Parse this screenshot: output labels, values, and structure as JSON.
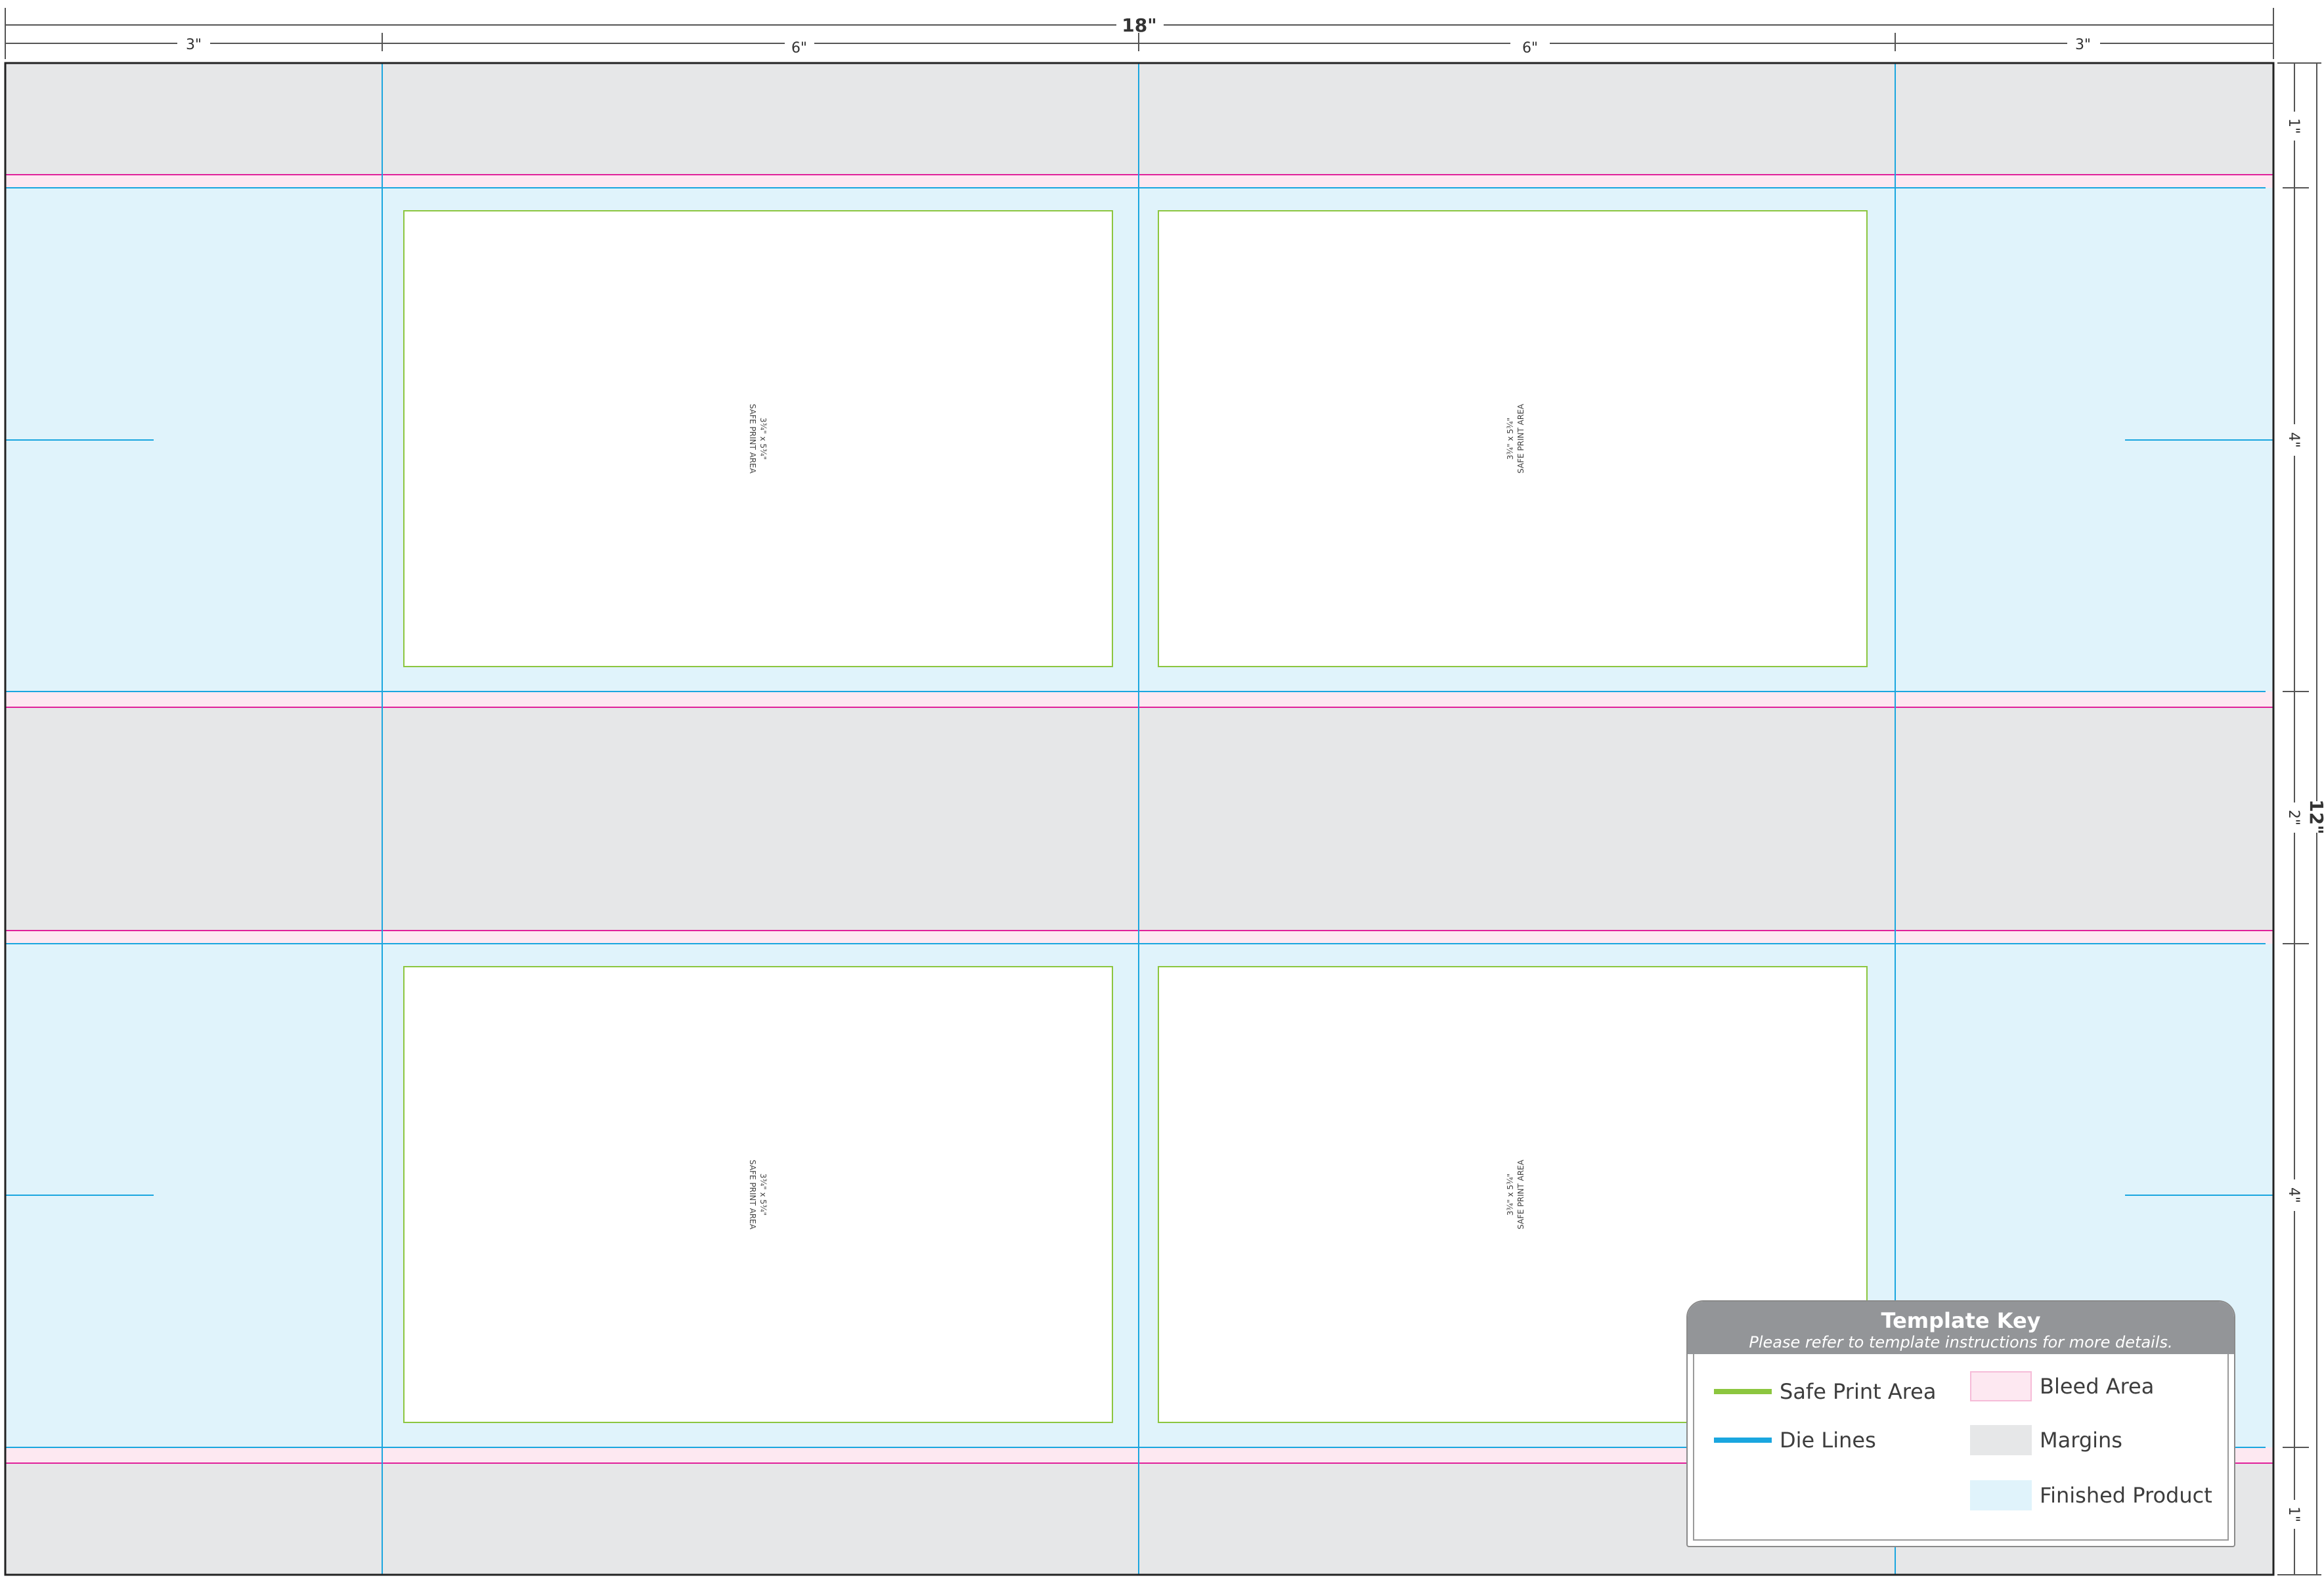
{
  "dimensions": {
    "total_width": "18\"",
    "total_height": "12\"",
    "top_segments": [
      "3\"",
      "6\"",
      "6\"",
      "3\""
    ],
    "right_segments": [
      "1\"",
      "4\"",
      "2\"",
      "4\"",
      "1\""
    ]
  },
  "cards": [
    {
      "label_line1": "3¾\" x 5¾\"",
      "label_line2": "SAFE PRINT AREA"
    },
    {
      "label_line1": "3¾\" x 5¾\"",
      "label_line2": "SAFE PRINT AREA"
    },
    {
      "label_line1": "3¾\" x 5¾\"",
      "label_line2": "SAFE PRINT AREA"
    },
    {
      "label_line1": "3¾\" x 5¾\"",
      "label_line2": "SAFE PRINT AREA"
    }
  ],
  "template_key": {
    "title": "Template Key",
    "subtitle": "Please refer to template instructions for more details.",
    "items": {
      "safe_print": "Safe Print Area",
      "die_lines": "Die Lines",
      "bleed": "Bleed Area",
      "margins": "Margins",
      "finished": "Finished Product"
    }
  },
  "colors": {
    "margins": "#e6e7e8",
    "finished": "#e0f3fb",
    "bleed": "#fde8f1",
    "bleed_line": "#e0219a",
    "die_line": "#1aa6df",
    "safe_line": "#8cc63f"
  }
}
